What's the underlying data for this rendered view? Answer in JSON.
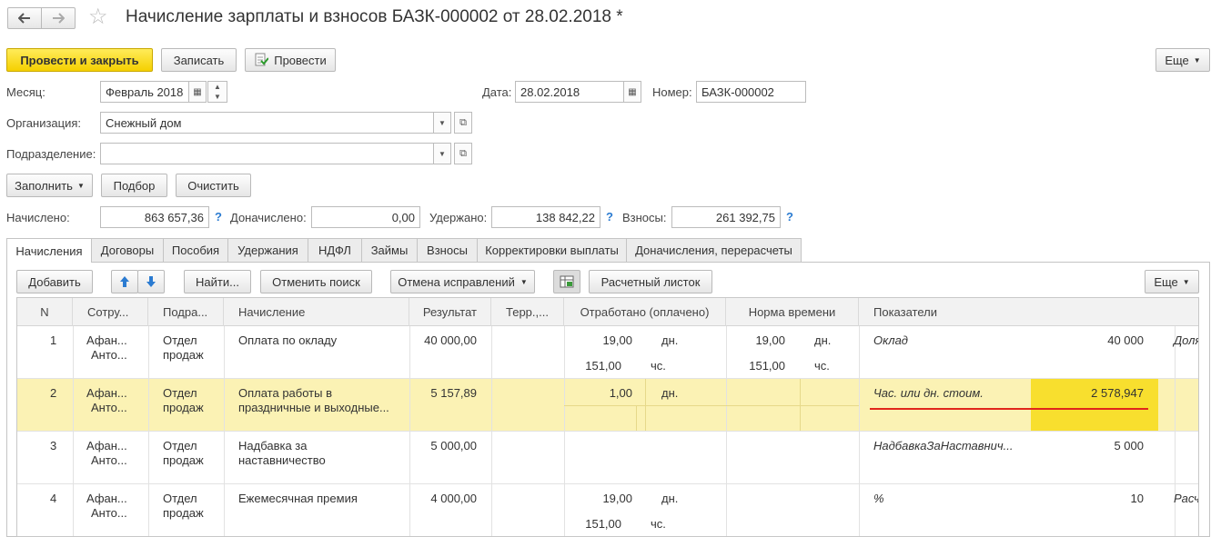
{
  "title": "Начисление зарплаты и взносов БАЗК-000002 от 28.02.2018 *",
  "toolbar": {
    "post_close": "Провести и закрыть",
    "save": "Записать",
    "post": "Провести",
    "more": "Еще"
  },
  "form": {
    "month_label": "Месяц:",
    "month_value": "Февраль 2018",
    "date_label": "Дата:",
    "date_value": "28.02.2018",
    "number_label": "Номер:",
    "number_value": "БАЗК-000002",
    "org_label": "Организация:",
    "org_value": "Снежный дом",
    "dept_label": "Подразделение:",
    "dept_value": ""
  },
  "actions": {
    "fill": "Заполнить",
    "select": "Подбор",
    "clear": "Очистить"
  },
  "totals": {
    "accrued_label": "Начислено:",
    "accrued": "863 657,36",
    "extra_label": "Доначислено:",
    "extra": "0,00",
    "withheld_label": "Удержано:",
    "withheld": "138 842,22",
    "contrib_label": "Взносы:",
    "contrib": "261 392,75",
    "help": "?"
  },
  "tabs": [
    "Начисления",
    "Договоры",
    "Пособия",
    "Удержания",
    "НДФЛ",
    "Займы",
    "Взносы",
    "Корректировки выплаты",
    "Доначисления, перерасчеты"
  ],
  "grid_toolbar": {
    "add": "Добавить",
    "find": "Найти...",
    "cancel_search": "Отменить поиск",
    "cancel_corrections": "Отмена исправлений",
    "payslip": "Расчетный листок",
    "more": "Еще"
  },
  "columns": [
    "N",
    "Сотру...",
    "Подра...",
    "Начисление",
    "Результат",
    "Терр.,...",
    "Отработано (оплачено)",
    "Норма времени",
    "Показатели"
  ],
  "rows": [
    {
      "n": "1",
      "emp1": "Афан...",
      "emp2": "Анто...",
      "dept1": "Отдел",
      "dept2": "продаж",
      "acc1": "Оплата по окладу",
      "acc2": "",
      "result": "40 000,00",
      "worked1": "19,00",
      "unit1": "дн.",
      "worked2": "151,00",
      "unit2": "чс.",
      "norm1": "19,00",
      "nunit1": "дн.",
      "norm2": "151,00",
      "nunit2": "чс.",
      "ind": "Оклад",
      "ind_val": "40 000",
      "extra": "Доля"
    },
    {
      "n": "2",
      "emp1": "Афан...",
      "emp2": "Анто...",
      "dept1": "Отдел",
      "dept2": "продаж",
      "acc1": "Оплата работы в",
      "acc2": "праздничные и выходные...",
      "result": "5 157,89",
      "worked1": "1,00",
      "unit1": "дн.",
      "worked2": "",
      "unit2": "",
      "norm1": "",
      "nunit1": "",
      "norm2": "",
      "nunit2": "",
      "ind": "Час. или дн. стоим.",
      "ind_val": "2 578,947",
      "extra": ""
    },
    {
      "n": "3",
      "emp1": "Афан...",
      "emp2": "Анто...",
      "dept1": "Отдел",
      "dept2": "продаж",
      "acc1": "Надбавка за",
      "acc2": "наставничество",
      "result": "5 000,00",
      "worked1": "",
      "unit1": "",
      "worked2": "",
      "unit2": "",
      "norm1": "",
      "nunit1": "",
      "norm2": "",
      "nunit2": "",
      "ind": "НадбавкаЗаНаставнич...",
      "ind_val": "5 000",
      "extra": ""
    },
    {
      "n": "4",
      "emp1": "Афан...",
      "emp2": "Анто...",
      "dept1": "Отдел",
      "dept2": "продаж",
      "acc1": "Ежемесячная премия",
      "acc2": "",
      "result": "4 000,00",
      "worked1": "19,00",
      "unit1": "дн.",
      "worked2": "151,00",
      "unit2": "чс.",
      "norm1": "",
      "nunit1": "",
      "norm2": "",
      "nunit2": "",
      "ind": "%",
      "ind_val": "10",
      "extra": "Расч"
    }
  ],
  "colors": {
    "accent_yellow": "#f5d000",
    "selected_row": "#fbf2b4",
    "highlight_cell": "#f8df2e",
    "underline_red": "#e0261c",
    "help_blue": "#2b7bd1"
  }
}
